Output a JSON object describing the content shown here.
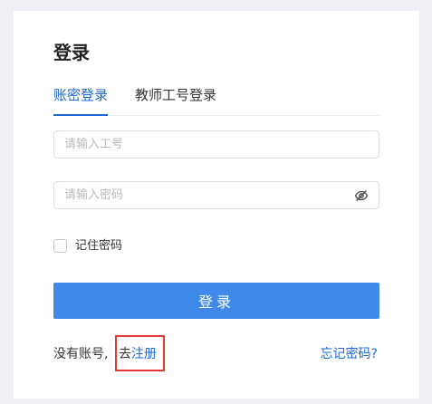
{
  "page": {
    "title": "登录"
  },
  "tabs": [
    {
      "label": "账密登录",
      "active": true
    },
    {
      "label": "教师工号登录",
      "active": false
    }
  ],
  "form": {
    "id_placeholder": "请输入工号",
    "id_value": "",
    "password_placeholder": "请输入密码",
    "password_value": "",
    "password_toggle_icon": "eye-off-icon",
    "remember_label": "记住密码",
    "remember_checked": false,
    "submit_label": "登录"
  },
  "footer": {
    "no_account_text": "没有账号,",
    "go_text": "去",
    "register_link": "注册",
    "forgot_link": "忘记密码?"
  },
  "colors": {
    "accent": "#1e67d6",
    "button": "#3f8ae8",
    "highlight": "#e53935",
    "background": "#eef0f6"
  }
}
